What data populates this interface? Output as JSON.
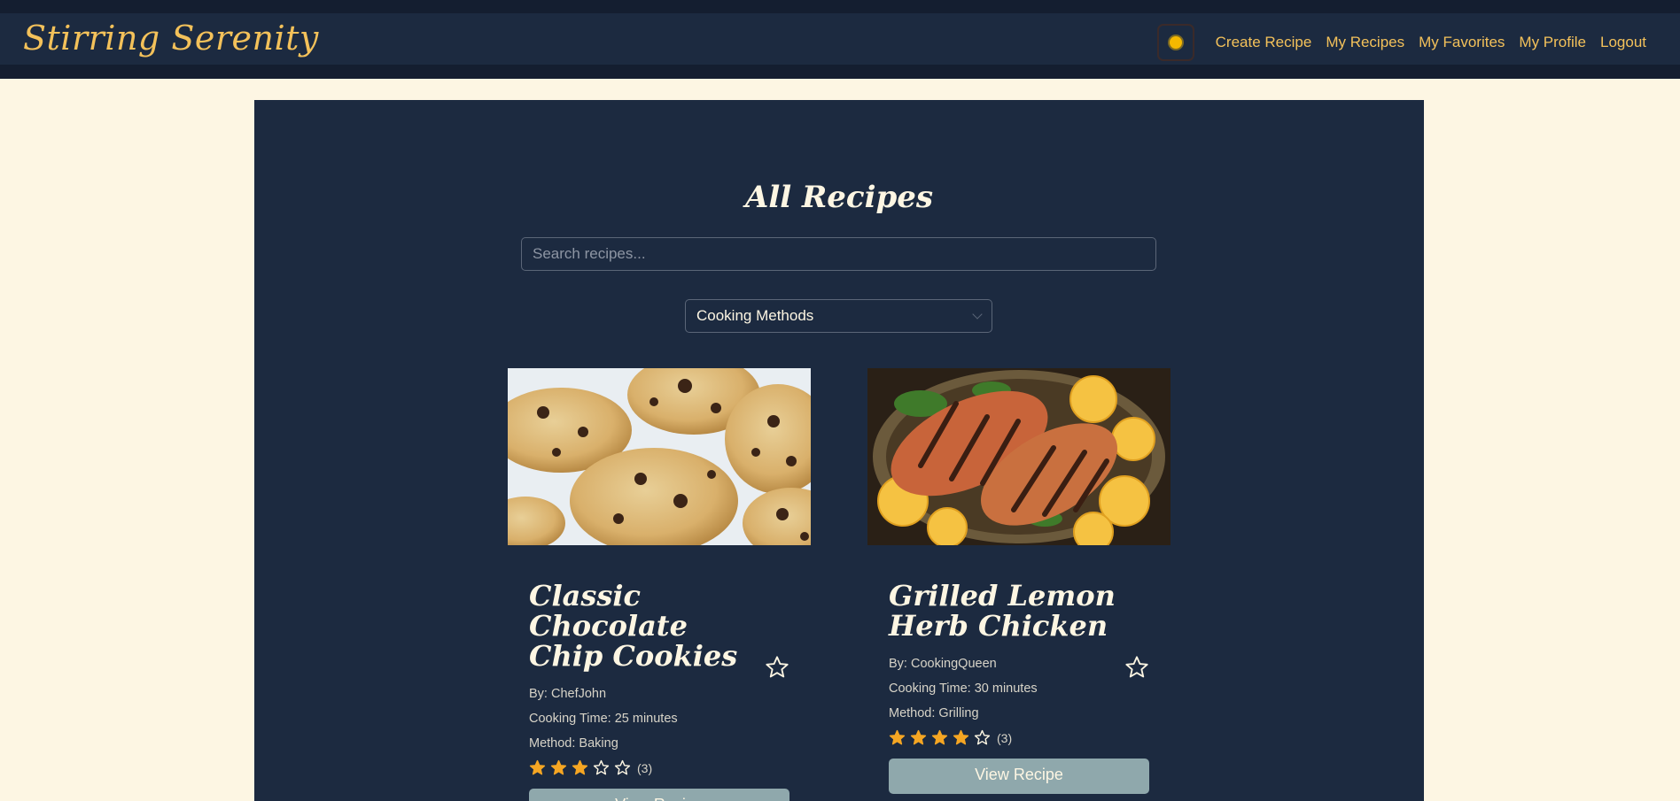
{
  "header": {
    "brand": "Stirring Serenity",
    "nav": [
      {
        "label": "Create Recipe"
      },
      {
        "label": "My Recipes"
      },
      {
        "label": "My Favorites"
      },
      {
        "label": "My Profile"
      },
      {
        "label": "Logout"
      }
    ],
    "theme_icon": "sun-icon"
  },
  "main": {
    "title": "All Recipes",
    "search": {
      "placeholder": "Search recipes...",
      "value": ""
    },
    "filter": {
      "selected": "Cooking Methods"
    }
  },
  "recipes": [
    {
      "title": "Classic Chocolate Chip Cookies",
      "author": "By: ChefJohn",
      "time": "Cooking Time: 25 minutes",
      "method": "Method: Baking",
      "rating": 3,
      "rating_count": "(3)",
      "button": "View Recipe",
      "image": "chocolate-chip-cookies-photo"
    },
    {
      "title": "Grilled Lemon Herb Chicken",
      "author": "By: CookingQueen",
      "time": "Cooking Time: 30 minutes",
      "method": "Method: Grilling",
      "rating": 4,
      "rating_count": "(3)",
      "button": "View Recipe",
      "image": "grilled-lemon-herb-chicken-photo"
    }
  ],
  "colors": {
    "accent": "#f3c15a",
    "panel": "#1c2a40",
    "page_bg": "#fdf6e3",
    "star_fill": "#f5a623",
    "button_bg": "#8fa8ac"
  }
}
